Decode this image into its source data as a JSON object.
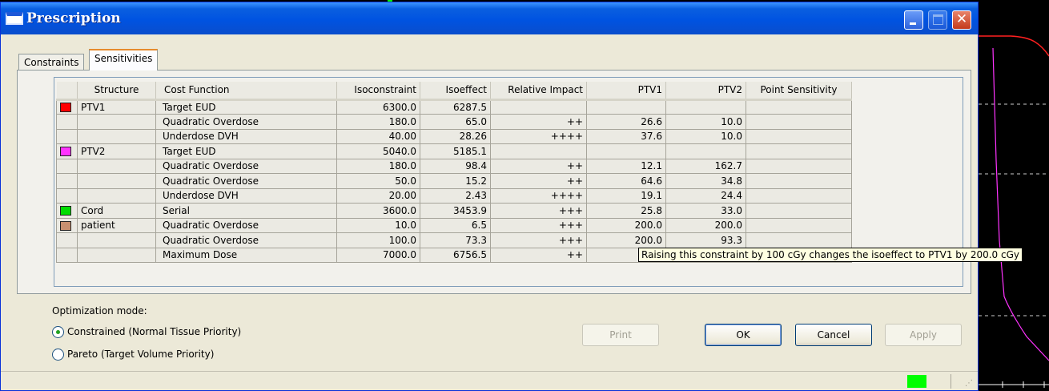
{
  "window": {
    "title": "Prescription"
  },
  "tabs": [
    {
      "label": "Constraints"
    },
    {
      "label": "Sensitivities"
    }
  ],
  "grid": {
    "columns": [
      "Structure",
      "Cost Function",
      "Isoconstraint",
      "Isoeffect",
      "Relative Impact",
      "PTV1",
      "PTV2",
      "Point Sensitivity"
    ],
    "rows": [
      {
        "structure": "PTV1",
        "color": "#ff0000",
        "cost_function": "Target EUD",
        "isoconstraint": "6300.0",
        "isoeffect": "6287.5",
        "impact": "",
        "ptv1": "",
        "ptv2": ""
      },
      {
        "structure": "",
        "color": "",
        "cost_function": "Quadratic Overdose",
        "isoconstraint": "180.0",
        "isoeffect": "65.0",
        "impact": "++",
        "ptv1": "26.6",
        "ptv2": "10.0"
      },
      {
        "structure": "",
        "color": "",
        "cost_function": "Underdose DVH",
        "isoconstraint": "40.00",
        "isoeffect": "28.26",
        "impact": "++++",
        "ptv1": "37.6",
        "ptv2": "10.0"
      },
      {
        "structure": "PTV2",
        "color": "#ff33ff",
        "cost_function": "Target EUD",
        "isoconstraint": "5040.0",
        "isoeffect": "5185.1",
        "impact": "",
        "ptv1": "",
        "ptv2": ""
      },
      {
        "structure": "",
        "color": "",
        "cost_function": "Quadratic Overdose",
        "isoconstraint": "180.0",
        "isoeffect": "98.4",
        "impact": "++",
        "ptv1": "12.1",
        "ptv2": "162.7"
      },
      {
        "structure": "",
        "color": "",
        "cost_function": "Quadratic Overdose",
        "isoconstraint": "50.0",
        "isoeffect": "15.2",
        "impact": "++",
        "ptv1": "64.6",
        "ptv2": "34.8"
      },
      {
        "structure": "",
        "color": "",
        "cost_function": "Underdose DVH",
        "isoconstraint": "20.00",
        "isoeffect": "2.43",
        "impact": "++++",
        "ptv1": "19.1",
        "ptv2": "24.4"
      },
      {
        "structure": "Cord",
        "color": "#00dd00",
        "cost_function": "Serial",
        "isoconstraint": "3600.0",
        "isoeffect": "3453.9",
        "impact": "+++",
        "ptv1": "25.8",
        "ptv2": "33.0"
      },
      {
        "structure": "patient",
        "color": "#c89070",
        "cost_function": "Quadratic Overdose",
        "isoconstraint": "10.0",
        "isoeffect": "6.5",
        "impact": "+++",
        "ptv1": "200.0",
        "ptv2": "200.0"
      },
      {
        "structure": "",
        "color": "",
        "cost_function": "Quadratic Overdose",
        "isoconstraint": "100.0",
        "isoeffect": "73.3",
        "impact": "+++",
        "ptv1": "200.0",
        "ptv2": "93.3"
      },
      {
        "structure": "",
        "color": "",
        "cost_function": "Maximum Dose",
        "isoconstraint": "7000.0",
        "isoeffect": "6756.5",
        "impact": "++",
        "ptv1": "20",
        "ptv2": ""
      }
    ]
  },
  "tooltip": {
    "text": "Raising this constraint by 100 cGy changes the isoeffect to PTV1 by 200.0 cGy"
  },
  "optimization": {
    "label": "Optimization mode:",
    "options": [
      {
        "label": "Constrained (Normal Tissue Priority)",
        "selected": true
      },
      {
        "label": "Pareto (Target Volume Priority)",
        "selected": false
      }
    ]
  },
  "buttons": {
    "print": "Print",
    "ok": "OK",
    "cancel": "Cancel",
    "apply": "Apply"
  },
  "status": {
    "indicator_color": "#00ff00"
  }
}
